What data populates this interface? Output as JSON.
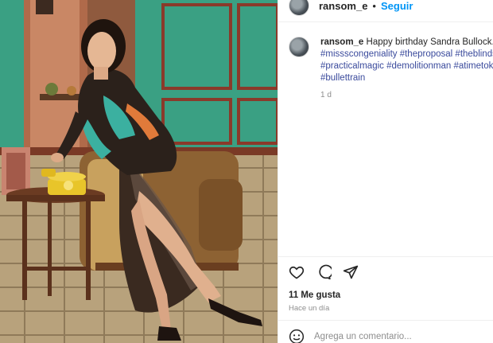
{
  "post": {
    "username": "ransom_e",
    "separator": "•",
    "follow_label": "Seguir",
    "caption_text": "Happy birthday Sandra Bullock.",
    "hashtags_line1_tail": "#s",
    "hashtags_line2": [
      "#missscongeniality",
      "#theproposal",
      "#theblindsid"
    ],
    "hashtags_line3": [
      "#practicalmagic",
      "#demolitionman",
      "#atimetoki"
    ],
    "hashtags_line4": [
      "#bullettrain"
    ],
    "caption_age": "1 d",
    "likes_label": "11 Me gusta",
    "posted_when": "Hace un día",
    "comment_placeholder": "Agrega un comentario..."
  },
  "icons": {
    "like": "heart-icon",
    "comment": "comment-bubble-icon",
    "share": "paper-plane-icon",
    "emoji": "emoji-smile-icon"
  },
  "colors": {
    "link_blue": "#0095f6",
    "hashtag": "#3a4a9c",
    "muted": "#8e8e8e",
    "wall_green": "#3fa587"
  }
}
